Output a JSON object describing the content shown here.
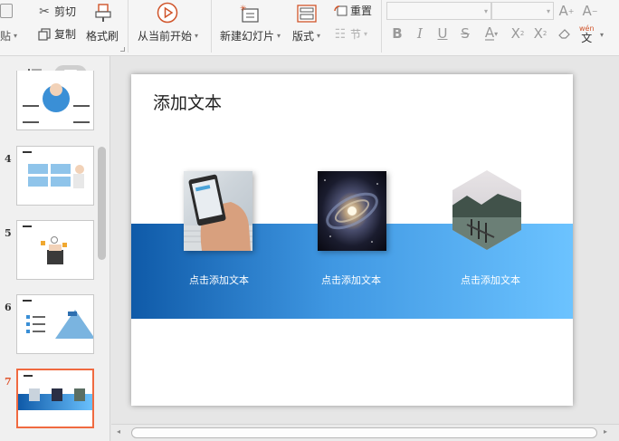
{
  "ribbon": {
    "paste": "贴",
    "cut": "剪切",
    "copy": "复制",
    "format_painter": "格式刷",
    "from_current": "从当前开始",
    "new_slide": "新建幻灯片",
    "layout": "版式",
    "reset": "重置",
    "section": "节",
    "phonetic": "wén",
    "phonetic_char": "文"
  },
  "slides": [
    {
      "number": "",
      "active": false
    },
    {
      "number": "4",
      "active": false
    },
    {
      "number": "5",
      "active": false
    },
    {
      "number": "6",
      "active": false
    },
    {
      "number": "7",
      "active": true
    }
  ],
  "slide": {
    "title": "添加文本",
    "captions": [
      "点击添加文本",
      "点击添加文本",
      "点击添加文本"
    ]
  },
  "colors": {
    "accent_active": "#f06a40",
    "band_start": "#0f5aa8",
    "band_end": "#6cc3ff"
  }
}
